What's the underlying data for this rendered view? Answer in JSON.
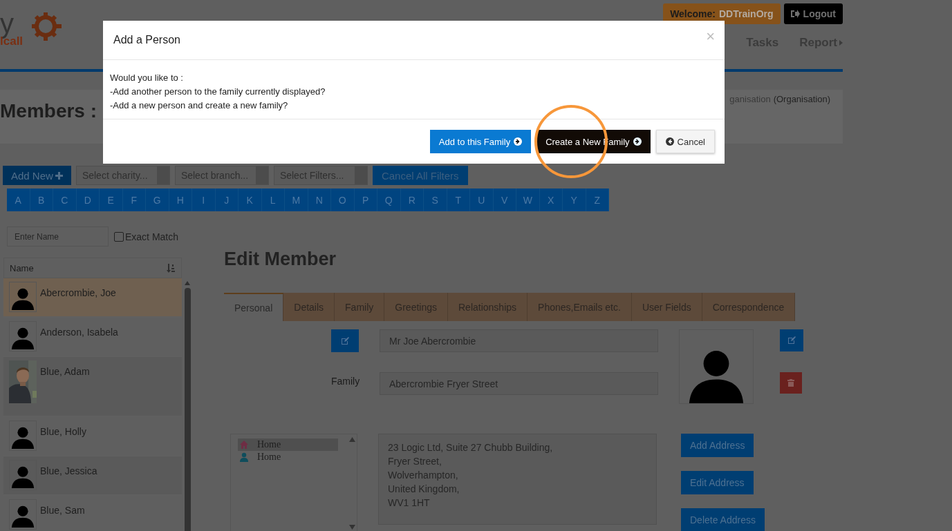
{
  "header": {
    "logo_text": "y",
    "logo_subtext": "lcall",
    "welcome_label": "Welcome:",
    "username": "DDTrainOrg",
    "logout": "Logout",
    "nav": [
      {
        "label": "Tasks",
        "submenu": false
      },
      {
        "label": "Report",
        "submenu": true
      }
    ]
  },
  "page": {
    "title": "Members :",
    "organisation_partial": "ganisation",
    "organisation_type": "(Organisation)"
  },
  "toolbar": {
    "add_new": "Add New",
    "filters": [
      {
        "placeholder": "Select charity..."
      },
      {
        "placeholder": "Select branch..."
      },
      {
        "placeholder": "Select Filters..."
      }
    ],
    "cancel_filters": "Cancel All Filters"
  },
  "alphabet": [
    "A",
    "B",
    "C",
    "D",
    "E",
    "F",
    "G",
    "H",
    "I",
    "J",
    "K",
    "L",
    "M",
    "N",
    "O",
    "P",
    "Q",
    "R",
    "S",
    "T",
    "U",
    "V",
    "W",
    "X",
    "Y",
    "Z"
  ],
  "search": {
    "placeholder": "Enter Name",
    "exact_match": {
      "label": "Exact Match",
      "checked": false
    }
  },
  "member_list": {
    "column": "Name",
    "members": [
      {
        "name": "Abercrombie, Joe",
        "selected": true,
        "kind": "silhouette"
      },
      {
        "name": "Anderson, Isabela",
        "selected": false,
        "kind": "silhouette"
      },
      {
        "name": "Blue, Adam",
        "selected": false,
        "kind": "picture"
      },
      {
        "name": "Blue, Holly",
        "selected": false,
        "kind": "silhouette"
      },
      {
        "name": "Blue, Jessica",
        "selected": false,
        "kind": "silhouette"
      },
      {
        "name": "Blue, Sam",
        "selected": false,
        "kind": "silhouette"
      }
    ]
  },
  "editor": {
    "title": "Edit Member",
    "tabs": [
      {
        "label": "Personal",
        "selected": true
      },
      {
        "label": "Details",
        "selected": false
      },
      {
        "label": "Family",
        "selected": false
      },
      {
        "label": "Greetings",
        "selected": false
      },
      {
        "label": "Relationships",
        "selected": false
      },
      {
        "label": "Phones,Emails etc.",
        "selected": false
      },
      {
        "label": "User Fields",
        "selected": false
      },
      {
        "label": "Correspondence",
        "selected": false
      }
    ],
    "full_name": "Mr Joe Abercrombie",
    "family_label": "Family",
    "family": "Abercrombie Fryer Street",
    "addresses": [
      {
        "label": "Home",
        "kind": "house",
        "selected": true
      },
      {
        "label": "Home",
        "kind": "person",
        "selected": false
      }
    ],
    "address_lines": [
      "23 Logic Ltd, Suite 27 Chubb Building,",
      "Fryer Street,",
      "Wolverhampton,",
      "United Kingdom,",
      "WV1 1HT"
    ],
    "address_buttons": [
      "Add Address",
      "Edit Address",
      "Delete Address"
    ]
  },
  "modal": {
    "title": "Add a Person",
    "close": "×",
    "lines": [
      "Would you like to :",
      "-Add another person to the family currently displayed?",
      "-Add a new person and create a new family?"
    ],
    "buttons": [
      {
        "label": "Add to this Family",
        "kind": "primary",
        "highlighted": false
      },
      {
        "label": "Create a New Family",
        "kind": "dark",
        "highlighted": true
      },
      {
        "label": "Cancel",
        "kind": "default",
        "highlighted": false
      }
    ]
  }
}
